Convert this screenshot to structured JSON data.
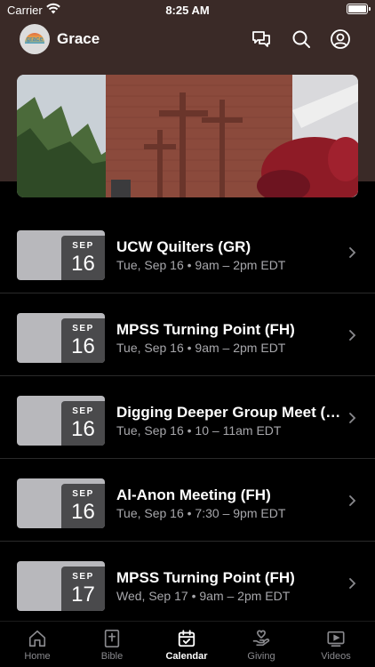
{
  "status_bar": {
    "carrier": "Carrier",
    "time": "8:25 AM"
  },
  "header": {
    "title": "Grace",
    "avatar_word": "grace"
  },
  "events": [
    {
      "month": "SEP",
      "day": "16",
      "title": "UCW Quilters (GR)",
      "meta": "Tue, Sep 16 • 9am – 2pm EDT"
    },
    {
      "month": "SEP",
      "day": "16",
      "title": "MPSS Turning Point (FH)",
      "meta": "Tue, Sep 16 • 9am – 2pm EDT"
    },
    {
      "month": "SEP",
      "day": "16",
      "title": "Digging Deeper Group Meet (L...",
      "meta": "Tue, Sep 16 • 10 – 11am EDT"
    },
    {
      "month": "SEP",
      "day": "16",
      "title": "Al-Anon Meeting (FH)",
      "meta": "Tue, Sep 16 • 7:30 – 9pm EDT"
    },
    {
      "month": "SEP",
      "day": "17",
      "title": "MPSS Turning Point (FH)",
      "meta": "Wed, Sep 17 • 9am – 2pm EDT"
    }
  ],
  "tabs": [
    {
      "label": "Home",
      "icon": "home-icon"
    },
    {
      "label": "Bible",
      "icon": "bible-icon"
    },
    {
      "label": "Calendar",
      "icon": "calendar-icon"
    },
    {
      "label": "Giving",
      "icon": "giving-icon"
    },
    {
      "label": "Videos",
      "icon": "videos-icon"
    }
  ],
  "active_tab": "Calendar",
  "colors": {
    "header_bg": "#3a2a27",
    "background": "#000000",
    "date_badge": "#4a4a4c",
    "date_tile": "#b8b8bc",
    "meta_text": "#a7a7ab"
  }
}
